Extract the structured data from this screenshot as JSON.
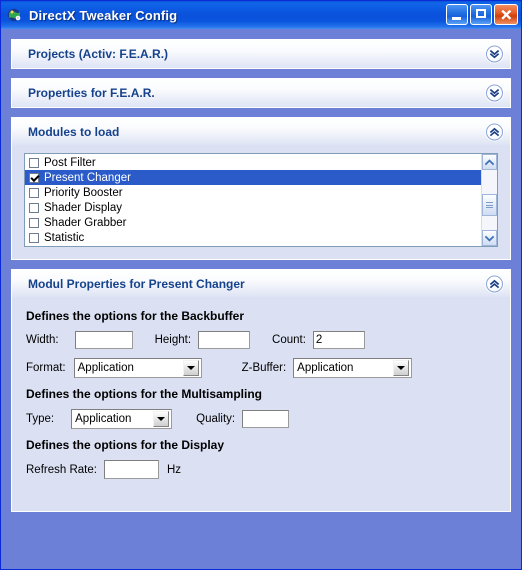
{
  "window": {
    "title": "DirectX Tweaker Config",
    "icon": "globe-icon",
    "controls": {
      "minimize": "Minimize",
      "maximize": "Maximize",
      "close": "Close"
    }
  },
  "colors": {
    "titlebar_blue": "#0a51dc",
    "client_background": "#6b80d6",
    "panel_body": "#dbe1f3",
    "panel_title_text": "#15428b",
    "selection_blue": "#2a5bc8",
    "close_button": "#e55a24"
  },
  "panels": [
    {
      "id": "projects",
      "title": "Projects (Activ: F.E.A.R.)",
      "collapsed": true,
      "chevron": "chevron-double-down-icon"
    },
    {
      "id": "properties",
      "title": "Properties for F.E.A.R.",
      "collapsed": true,
      "chevron": "chevron-double-down-icon"
    },
    {
      "id": "modules",
      "title": "Modules to load",
      "collapsed": false,
      "chevron": "chevron-double-up-icon"
    },
    {
      "id": "modul-properties",
      "title": "Modul Properties for Present Changer",
      "collapsed": false,
      "chevron": "chevron-double-up-icon"
    }
  ],
  "modules_list": {
    "items": [
      {
        "label": "Post Filter",
        "checked": false,
        "selected": false
      },
      {
        "label": "Present Changer",
        "checked": true,
        "selected": true
      },
      {
        "label": "Priority Booster",
        "checked": false,
        "selected": false
      },
      {
        "label": "Shader Display",
        "checked": false,
        "selected": false
      },
      {
        "label": "Shader Grabber",
        "checked": false,
        "selected": false
      },
      {
        "label": "Statistic",
        "checked": false,
        "selected": false
      }
    ],
    "scrollbar": {
      "up_icon": "chevron-up-icon",
      "down_icon": "chevron-down-icon",
      "thumb": "scrollbar-thumb"
    }
  },
  "modul_properties": {
    "backbuffer": {
      "heading": "Defines the options for the Backbuffer",
      "width_label": "Width:",
      "width_value": "",
      "height_label": "Height:",
      "height_value": "",
      "count_label": "Count:",
      "count_value": "2",
      "format_label": "Format:",
      "format_value": "Application",
      "zbuffer_label": "Z-Buffer:",
      "zbuffer_value": "Application"
    },
    "multisampling": {
      "heading": "Defines the options for the Multisampling",
      "type_label": "Type:",
      "type_value": "Application",
      "quality_label": "Quality:",
      "quality_value": ""
    },
    "display": {
      "heading": "Defines the options for the Display",
      "refresh_label": "Refresh Rate:",
      "refresh_value": "",
      "refresh_unit": "Hz"
    }
  }
}
